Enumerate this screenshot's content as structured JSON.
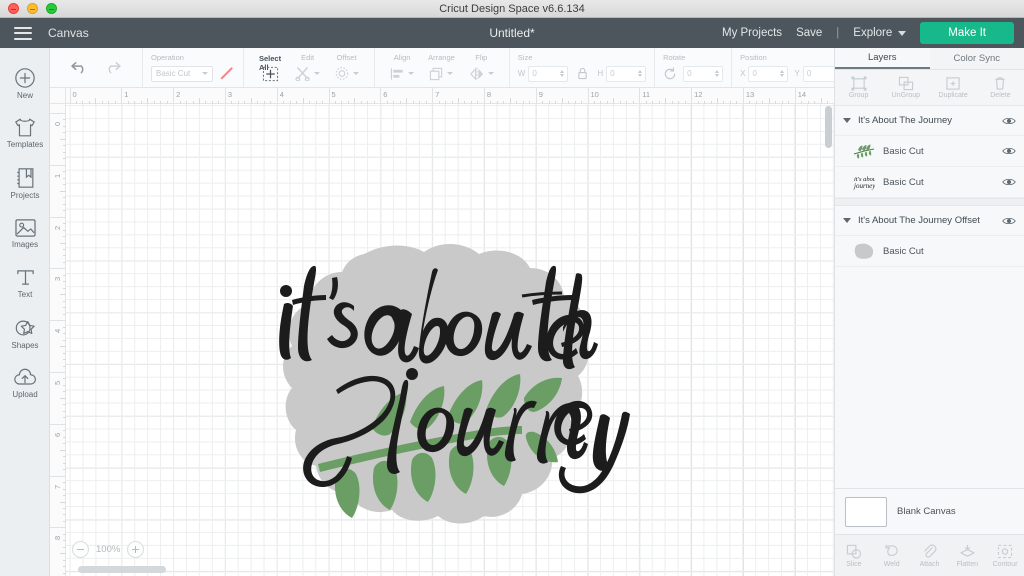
{
  "window": {
    "app_title": "Cricut Design Space  v6.6.134",
    "controls": [
      "close",
      "minimize",
      "maximize"
    ]
  },
  "header": {
    "menu_icon": "hamburger-icon",
    "canvas_label": "Canvas",
    "document_title": "Untitled*",
    "my_projects": "My Projects",
    "save": "Save",
    "separator": "|",
    "machine": "Explore",
    "make_it": "Make It",
    "bg_color": "#4c565c",
    "make_it_color": "#17b88a"
  },
  "rail": {
    "items": [
      {
        "label": "New",
        "icon": "plus-circle-icon"
      },
      {
        "label": "Templates",
        "icon": "tshirt-icon"
      },
      {
        "label": "Projects",
        "icon": "book-icon"
      },
      {
        "label": "Images",
        "icon": "image-icon"
      },
      {
        "label": "Text",
        "icon": "text-t-icon"
      },
      {
        "label": "Shapes",
        "icon": "star-shape-icon"
      },
      {
        "label": "Upload",
        "icon": "cloud-upload-icon"
      }
    ]
  },
  "toolbar": {
    "undo": "undo-icon",
    "redo": "redo-icon",
    "operation": {
      "label": "Operation",
      "value": "Basic Cut",
      "swatch_color": "#f0868c"
    },
    "select_all": {
      "label": "Select All",
      "enabled": true
    },
    "edit": {
      "label": "Edit",
      "enabled": false
    },
    "offset": {
      "label": "Offset",
      "enabled": false
    },
    "align": {
      "label": "Align",
      "enabled": false
    },
    "arrange": {
      "label": "Arrange",
      "enabled": false
    },
    "flip": {
      "label": "Flip",
      "enabled": false
    },
    "size": {
      "label": "Size",
      "w_label": "W",
      "w_value": "0",
      "h_label": "H",
      "h_value": "0",
      "lock": "lock-icon"
    },
    "rotate": {
      "label": "Rotate",
      "value": "0",
      "icon": "rotate-icon"
    },
    "position": {
      "label": "Position",
      "x_label": "X",
      "x_value": "0",
      "y_label": "Y",
      "y_value": "0"
    }
  },
  "canvas": {
    "ruler_h_numbers": [
      "0",
      "1",
      "2",
      "3",
      "4",
      "5",
      "6",
      "7",
      "8",
      "9",
      "10",
      "11",
      "12",
      "13",
      "14"
    ],
    "ruler_v_numbers": [
      "0",
      "1",
      "2",
      "3",
      "4",
      "5",
      "6",
      "7",
      "8"
    ],
    "zoom_level": "100%",
    "zoom_out_icon": "minus-circle-icon",
    "zoom_in_icon": "plus-circle-icon",
    "artwork": {
      "text_line_1": "it's about the",
      "text_line_2": "journey",
      "text_color": "#1c1c1c",
      "leaf_color": "#6b9e65",
      "offset_color": "#c9c9c9"
    }
  },
  "panel": {
    "tabs": [
      {
        "label": "Layers",
        "active": true
      },
      {
        "label": "Color Sync",
        "active": false
      }
    ],
    "actions": [
      {
        "label": "Group",
        "icon": "group-icon",
        "enabled": false
      },
      {
        "label": "UnGroup",
        "icon": "ungroup-icon",
        "enabled": false
      },
      {
        "label": "Duplicate",
        "icon": "duplicate-icon",
        "enabled": false
      },
      {
        "label": "Delete",
        "icon": "trash-icon",
        "enabled": false
      }
    ],
    "layers": [
      {
        "name": "It's About The Journey",
        "expanded": true,
        "visible": true,
        "children": [
          {
            "name": "Basic Cut",
            "thumb": "leaf-thumb",
            "visible": true
          },
          {
            "name": "Basic Cut",
            "thumb": "script-text-thumb",
            "visible": true
          }
        ]
      },
      {
        "name": "It's About The Journey Offset",
        "expanded": true,
        "visible": true,
        "children": [
          {
            "name": "Basic Cut",
            "thumb": "offset-blob-thumb",
            "visible": false
          }
        ]
      }
    ],
    "canvas_swatch": {
      "label": "Blank Canvas",
      "color": "#ffffff"
    },
    "bottom_tools": [
      {
        "label": "Slice",
        "icon": "slice-icon"
      },
      {
        "label": "Weld",
        "icon": "weld-icon"
      },
      {
        "label": "Attach",
        "icon": "paperclip-icon"
      },
      {
        "label": "Flatten",
        "icon": "flatten-icon"
      },
      {
        "label": "Contour",
        "icon": "contour-icon"
      }
    ]
  }
}
